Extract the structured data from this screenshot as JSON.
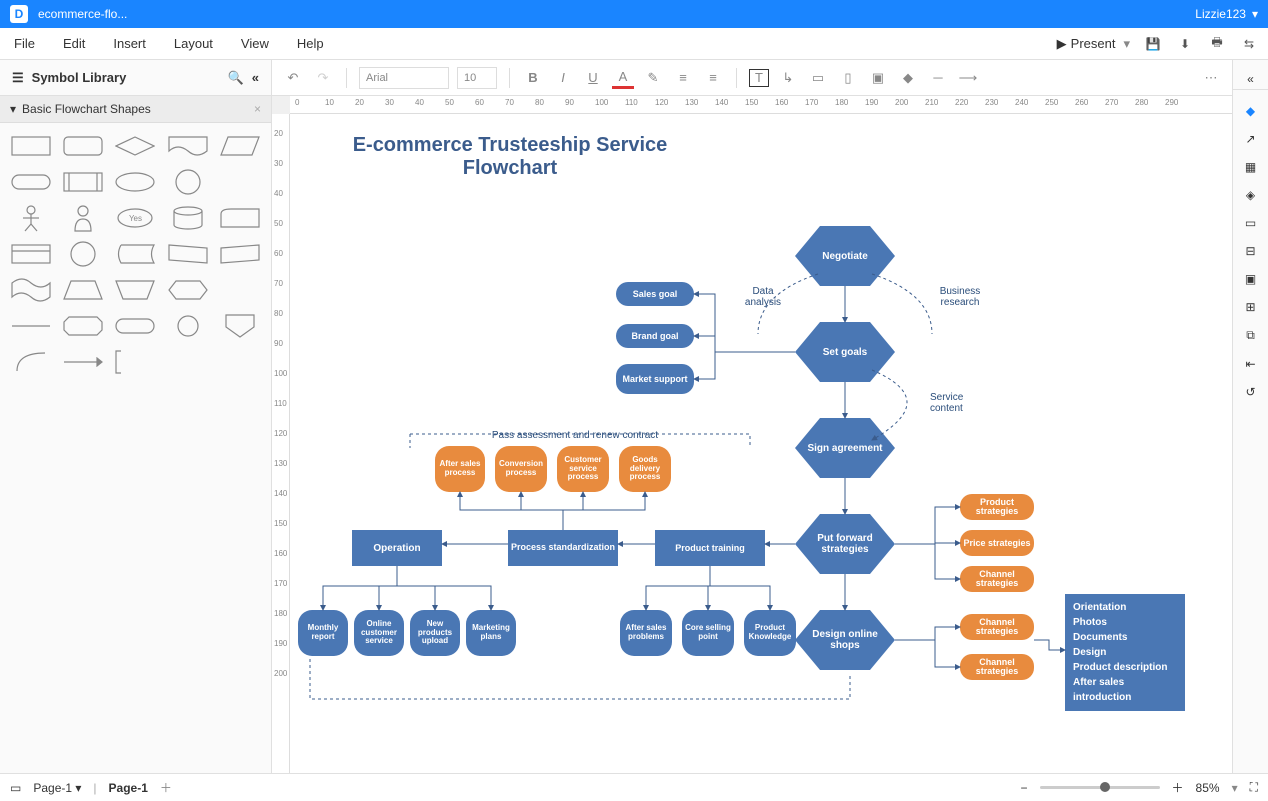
{
  "title": "ecommerce-flo...",
  "user": "Lizzie123",
  "menus": [
    "File",
    "Edit",
    "Insert",
    "Layout",
    "View",
    "Help"
  ],
  "present": "Present",
  "sidebar_title": "Symbol Library",
  "shape_section": "Basic Flowchart Shapes",
  "shape_yes": "Yes",
  "font_name": "Arial",
  "font_size": "10",
  "page_tab": "Page-1",
  "page_label": "Page-1",
  "zoom": "85%",
  "diagram": {
    "title": "E-commerce Trusteeship Service Flowchart",
    "negotiate": "Negotiate",
    "setgoals": "Set goals",
    "sign": "Sign agreement",
    "forward": "Put forward strategies",
    "design": "Design online shops",
    "sales_goal": "Sales goal",
    "brand_goal": "Brand goal",
    "market": "Market support",
    "data_analysis": "Data analysis",
    "biz_research": "Business research",
    "service_content": "Service content",
    "pass": "Pass assessment and renew contract",
    "after_sales_p": "After sales process",
    "conversion": "Conversion process",
    "customer_svc": "Customer service process",
    "goods_delivery": "Goods delivery process",
    "operation": "Operation",
    "process_std": "Process standardization",
    "product_training": "Product training",
    "monthly": "Monthly report",
    "online_cust": "Online customer service",
    "new_prod": "New products upload",
    "marketing": "Marketing plans",
    "after_sales_prob": "After sales problems",
    "core_selling": "Core selling point",
    "product_know": "Product Knowledge",
    "prod_strat": "Product strategies",
    "price_strat": "Price strategies",
    "channel_strat": "Channel strategies",
    "channel_strat2": "Channel strategies",
    "channel_strat3": "Channel strategies",
    "list": [
      "Orientation",
      "Photos",
      "Documents",
      "Design",
      "Product description",
      "After sales",
      "introduction"
    ]
  }
}
